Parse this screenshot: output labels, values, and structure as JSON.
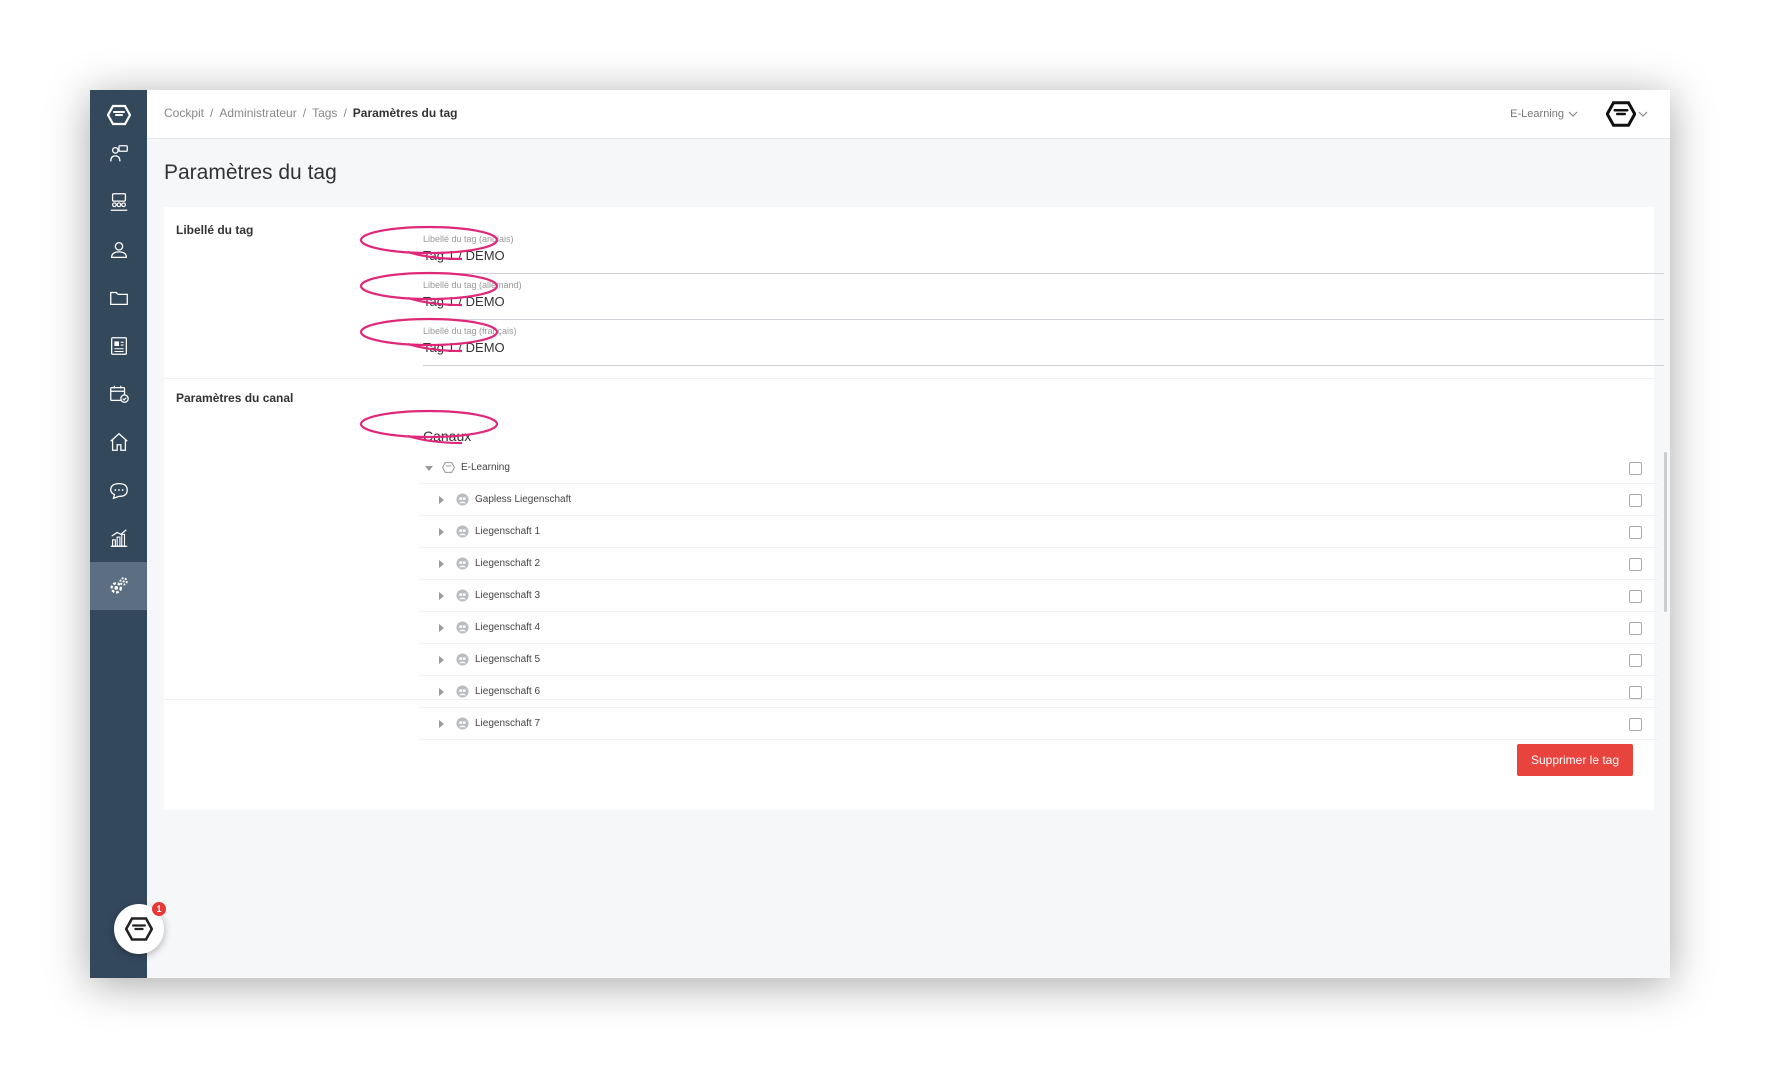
{
  "breadcrumb": {
    "items": [
      "Cockpit",
      "Administrateur",
      "Tags"
    ],
    "current": "Paramètres du tag"
  },
  "header": {
    "org_selector": "E-Learning"
  },
  "page": {
    "title": "Paramètres du tag"
  },
  "tag_labels": {
    "section_label": "Libellé du tag",
    "fields": [
      {
        "label": "Libellé du tag (anglais)",
        "value": "Tag 1 / DEMO"
      },
      {
        "label": "Libellé du tag (allemand)",
        "value": "Tag 1 / DEMO"
      },
      {
        "label": "Libellé du tag (français)",
        "value": "Tag 1 / DEMO"
      }
    ]
  },
  "channels": {
    "section_label": "Paramètres du canal",
    "title": "Canaux",
    "root": {
      "label": "E-Learning",
      "expanded": true,
      "checked": false
    },
    "children": [
      {
        "label": "Gapless Liegenschaft",
        "checked": false
      },
      {
        "label": "Liegenschaft 1",
        "checked": false
      },
      {
        "label": "Liegenschaft 2",
        "checked": false
      },
      {
        "label": "Liegenschaft 3",
        "checked": false
      },
      {
        "label": "Liegenschaft 4",
        "checked": false
      },
      {
        "label": "Liegenschaft 5",
        "checked": false
      },
      {
        "label": "Liegenschaft 6",
        "checked": false
      },
      {
        "label": "Liegenschaft 7",
        "checked": false
      }
    ]
  },
  "actions": {
    "delete_label": "Supprimer le tag"
  },
  "chat": {
    "badge_count": "1"
  },
  "sidebar": {
    "icons": [
      "logo-icon",
      "presenter-icon",
      "group-icon",
      "user-icon",
      "folder-icon",
      "report-icon",
      "calendar-icon",
      "home-icon",
      "chat-icon",
      "chart-icon",
      "settings-icon"
    ],
    "active": "settings-icon"
  },
  "colors": {
    "sidebar": "#34485c",
    "sidebar_active": "#5c6f82",
    "delete_button": "#e8433d",
    "annotation": "#e0287a"
  }
}
